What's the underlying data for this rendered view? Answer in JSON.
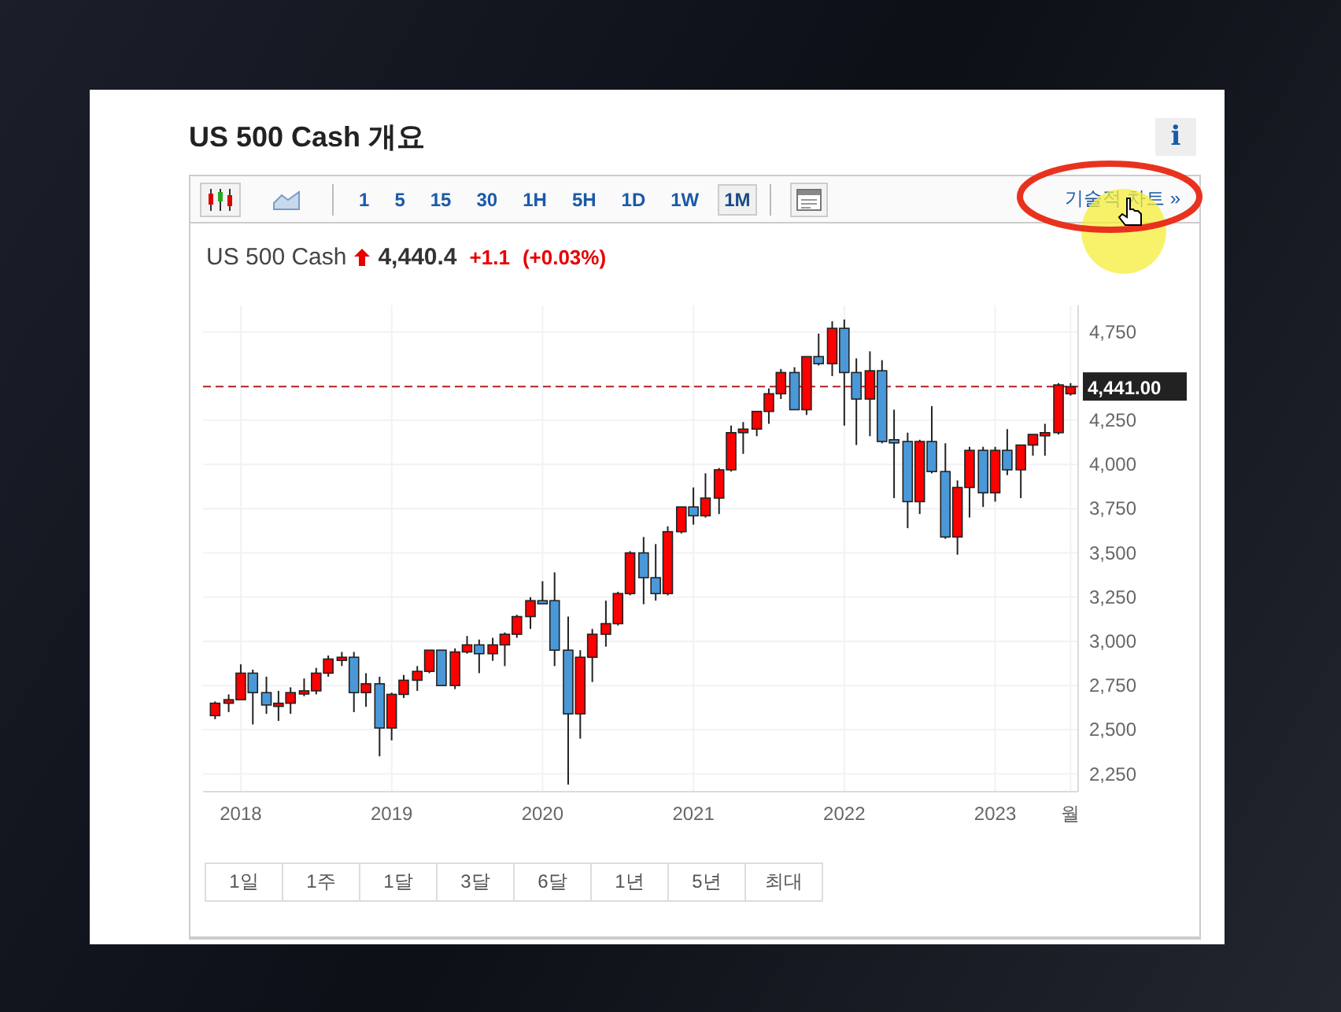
{
  "widget": {
    "title": "US 500 Cash 개요",
    "info_button": "i"
  },
  "toolbar": {
    "chart_types": [
      {
        "kind": "candle",
        "selected": true
      },
      {
        "kind": "area",
        "selected": false
      }
    ],
    "intervals": [
      {
        "label": "1",
        "selected": false
      },
      {
        "label": "5",
        "selected": false
      },
      {
        "label": "15",
        "selected": false
      },
      {
        "label": "30",
        "selected": false
      },
      {
        "label": "1H",
        "selected": false
      },
      {
        "label": "5H",
        "selected": false
      },
      {
        "label": "1D",
        "selected": false
      },
      {
        "label": "1W",
        "selected": false
      },
      {
        "label": "1M",
        "selected": true
      }
    ],
    "link": "기술적 차트 »"
  },
  "quote": {
    "name": "US 500 Cash",
    "up": true,
    "price": "4,440.4",
    "change": "+1.1",
    "change_pct": "(+0.03%)"
  },
  "chart_data": {
    "type": "candlestick",
    "grid": true,
    "x": [
      2017.83,
      2017.92,
      2018.0,
      2018.08,
      2018.17,
      2018.25,
      2018.33,
      2018.42,
      2018.5,
      2018.58,
      2018.67,
      2018.75,
      2018.83,
      2018.92,
      2019.0,
      2019.08,
      2019.17,
      2019.25,
      2019.33,
      2019.42,
      2019.5,
      2019.58,
      2019.67,
      2019.75,
      2019.83,
      2019.92,
      2020.0,
      2020.08,
      2020.17,
      2020.25,
      2020.33,
      2020.42,
      2020.5,
      2020.58,
      2020.67,
      2020.75,
      2020.83,
      2020.92,
      2021.0,
      2021.08,
      2021.17,
      2021.25,
      2021.33,
      2021.42,
      2021.5,
      2021.58,
      2021.67,
      2021.75,
      2021.83,
      2021.92,
      2022.0,
      2022.08,
      2022.17,
      2022.25,
      2022.33,
      2022.42,
      2022.5,
      2022.58,
      2022.67,
      2022.75,
      2022.83,
      2022.92,
      2023.0,
      2023.08,
      2023.17,
      2023.25,
      2023.33,
      2023.42,
      2023.5
    ],
    "ohlc": [
      [
        2580,
        2660,
        2560,
        2650
      ],
      [
        2650,
        2700,
        2600,
        2670
      ],
      [
        2670,
        2870,
        2670,
        2820
      ],
      [
        2820,
        2840,
        2530,
        2710
      ],
      [
        2710,
        2800,
        2590,
        2640
      ],
      [
        2640,
        2720,
        2550,
        2650
      ],
      [
        2650,
        2740,
        2590,
        2710
      ],
      [
        2710,
        2790,
        2690,
        2720
      ],
      [
        2720,
        2850,
        2700,
        2820
      ],
      [
        2820,
        2920,
        2800,
        2900
      ],
      [
        2900,
        2940,
        2860,
        2910
      ],
      [
        2910,
        2940,
        2600,
        2710
      ],
      [
        2710,
        2820,
        2630,
        2760
      ],
      [
        2760,
        2800,
        2350,
        2510
      ],
      [
        2510,
        2710,
        2440,
        2700
      ],
      [
        2700,
        2810,
        2680,
        2780
      ],
      [
        2780,
        2860,
        2720,
        2830
      ],
      [
        2830,
        2950,
        2820,
        2950
      ],
      [
        2950,
        2950,
        2750,
        2750
      ],
      [
        2750,
        2960,
        2730,
        2940
      ],
      [
        2940,
        3030,
        2930,
        2980
      ],
      [
        2980,
        3010,
        2820,
        2930
      ],
      [
        2930,
        3020,
        2890,
        2980
      ],
      [
        2980,
        3050,
        2860,
        3040
      ],
      [
        3040,
        3150,
        3020,
        3140
      ],
      [
        3140,
        3250,
        3070,
        3230
      ],
      [
        3230,
        3340,
        3210,
        3220
      ],
      [
        3230,
        3390,
        2860,
        2950
      ],
      [
        2950,
        3140,
        2190,
        2590
      ],
      [
        2590,
        2950,
        2450,
        2910
      ],
      [
        2910,
        3070,
        2770,
        3040
      ],
      [
        3040,
        3230,
        2970,
        3100
      ],
      [
        3100,
        3280,
        3090,
        3270
      ],
      [
        3270,
        3510,
        3260,
        3500
      ],
      [
        3500,
        3590,
        3210,
        3360
      ],
      [
        3360,
        3550,
        3230,
        3270
      ],
      [
        3270,
        3650,
        3260,
        3620
      ],
      [
        3620,
        3760,
        3610,
        3760
      ],
      [
        3760,
        3870,
        3660,
        3710
      ],
      [
        3710,
        3950,
        3700,
        3810
      ],
      [
        3810,
        3980,
        3720,
        3970
      ],
      [
        3970,
        4220,
        3960,
        4180
      ],
      [
        4180,
        4240,
        4060,
        4200
      ],
      [
        4200,
        4300,
        4160,
        4300
      ],
      [
        4300,
        4430,
        4230,
        4400
      ],
      [
        4400,
        4540,
        4370,
        4520
      ],
      [
        4520,
        4550,
        4310,
        4310
      ],
      [
        4310,
        4610,
        4280,
        4610
      ],
      [
        4610,
        4740,
        4560,
        4570
      ],
      [
        4570,
        4810,
        4500,
        4770
      ],
      [
        4770,
        4820,
        4220,
        4520
      ],
      [
        4520,
        4600,
        4110,
        4370
      ],
      [
        4370,
        4640,
        4160,
        4530
      ],
      [
        4530,
        4590,
        4120,
        4130
      ],
      [
        4140,
        4310,
        3810,
        4130
      ],
      [
        4130,
        4180,
        3640,
        3790
      ],
      [
        3790,
        4140,
        3720,
        4130
      ],
      [
        4130,
        4330,
        3950,
        3960
      ],
      [
        3960,
        4120,
        3580,
        3590
      ],
      [
        3590,
        3910,
        3490,
        3870
      ],
      [
        3870,
        4100,
        3700,
        4080
      ],
      [
        4080,
        4100,
        3760,
        3840
      ],
      [
        3840,
        4100,
        3790,
        4080
      ],
      [
        4080,
        4200,
        3940,
        3970
      ],
      [
        3970,
        4110,
        3810,
        4110
      ],
      [
        4110,
        4170,
        4050,
        4170
      ],
      [
        4170,
        4230,
        4050,
        4180
      ],
      [
        4180,
        4460,
        4170,
        4450
      ],
      [
        4400,
        4460,
        4390,
        4440
      ]
    ],
    "xlim": [
      2017.75,
      2023.55
    ],
    "ylim": [
      2150,
      4900
    ],
    "yticks": [
      {
        "value": 2250,
        "label": "2,250"
      },
      {
        "value": 2500,
        "label": "2,500"
      },
      {
        "value": 2750,
        "label": "2,750"
      },
      {
        "value": 3000,
        "label": "3,000"
      },
      {
        "value": 3250,
        "label": "3,250"
      },
      {
        "value": 3500,
        "label": "3,500"
      },
      {
        "value": 3750,
        "label": "3,750"
      },
      {
        "value": 4000,
        "label": "4,000"
      },
      {
        "value": 4250,
        "label": "4,250"
      },
      {
        "value": 4750,
        "label": "4,750"
      }
    ],
    "xticks": [
      {
        "value": 2018,
        "label": "2018"
      },
      {
        "value": 2019,
        "label": "2019"
      },
      {
        "value": 2020,
        "label": "2020"
      },
      {
        "value": 2021,
        "label": "2021"
      },
      {
        "value": 2022,
        "label": "2022"
      },
      {
        "value": 2023,
        "label": "2023"
      },
      {
        "value": 2023.5,
        "label": "월"
      }
    ],
    "ref_lines": [
      {
        "axis": "y",
        "value": 4441,
        "label": "4,441.00"
      }
    ]
  },
  "ranges": [
    {
      "label": "1일"
    },
    {
      "label": "1주"
    },
    {
      "label": "1달"
    },
    {
      "label": "3달"
    },
    {
      "label": "6달"
    },
    {
      "label": "1년"
    },
    {
      "label": "5년"
    },
    {
      "label": "최대"
    }
  ]
}
